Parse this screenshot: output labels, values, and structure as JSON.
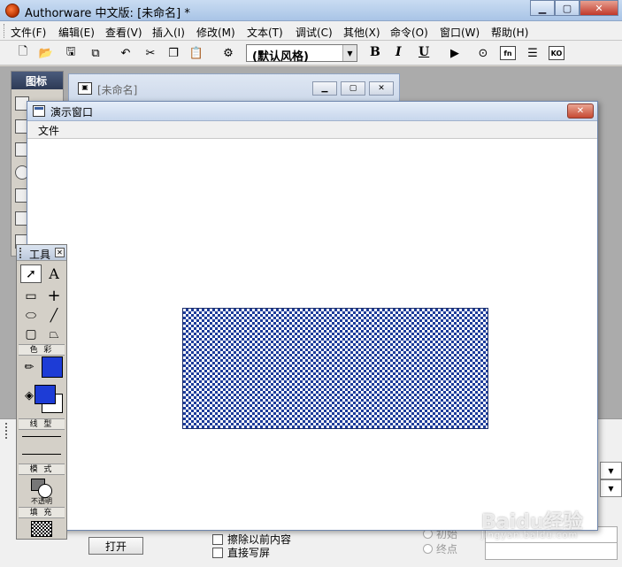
{
  "app": {
    "title": "Authorware 中文版: [未命名] *",
    "window_buttons": {
      "minimize": "▁",
      "maximize": "▢",
      "close": "✕"
    }
  },
  "menu": {
    "items": [
      "文件(F)",
      "编辑(E)",
      "查看(V)",
      "插入(I)",
      "修改(M)",
      "文本(T)",
      "调试(C)",
      "其他(X)",
      "命令(O)",
      "窗口(W)",
      "帮助(H)"
    ]
  },
  "toolbar": {
    "style_value": "(默认风格)",
    "bold": "B",
    "italic": "I",
    "underline": "U",
    "fn_label": "fn",
    "ko_label": "KO"
  },
  "icon_palette": {
    "title": "图标"
  },
  "flow_window": {
    "title": "[未命名]"
  },
  "presentation": {
    "title": "演示窗口",
    "close": "✕",
    "menu_file": "文件",
    "fill_color": "#1d3c9a"
  },
  "tools": {
    "title": "工具",
    "close": "✕",
    "text_tool": "A",
    "color_label": "色 彩",
    "line_label": "线 型",
    "mode_label": "模 式",
    "mode_value": "不透明",
    "fill_label": "填 充",
    "line_color": "#1d3cd6",
    "fill_fg_color": "#1d3cd6",
    "fill_bg_color": "#ffffff"
  },
  "properties": {
    "open_button": "打开",
    "checkbox_erase": "擦除以前内容",
    "checkbox_direct": "直接写屏",
    "radio_start": "初始",
    "radio_end": "终点"
  },
  "watermark": {
    "brand": "Baidu经验",
    "sub": "jingyan.baidu.com"
  }
}
